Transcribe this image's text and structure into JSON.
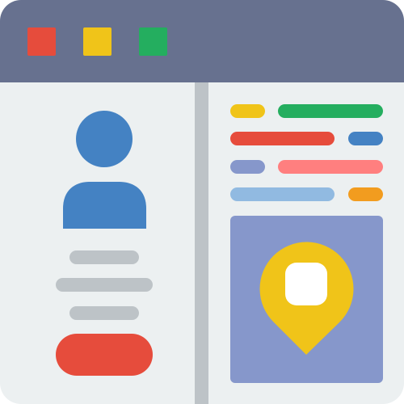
{
  "window": {
    "frame_color": "#ECF0F1",
    "titlebar_color": "#67718F",
    "divider_color": "#BDC3C7",
    "controls": [
      {
        "name": "close",
        "color": "#E64C3C"
      },
      {
        "name": "minimize",
        "color": "#F0C419"
      },
      {
        "name": "maximize",
        "color": "#24AE5F"
      }
    ]
  },
  "profile": {
    "icon": "user-avatar-icon",
    "avatar_color": "#4482C3",
    "text_line_color": "#BDC3C7",
    "action_button_color": "#E64C3C"
  },
  "details": {
    "rows": [
      [
        {
          "color": "#F0C419"
        },
        {
          "color": "#24AE5F"
        }
      ],
      [
        {
          "color": "#E64C3C"
        },
        {
          "color": "#4482C3"
        }
      ],
      [
        {
          "color": "#8697CB"
        },
        {
          "color": "#FF7F7F"
        }
      ],
      [
        {
          "color": "#91BAE1"
        },
        {
          "color": "#F29C1F"
        }
      ]
    ]
  },
  "map": {
    "background_color": "#8697CB",
    "pin_icon": "map-pin-icon",
    "pin_color": "#F0C419",
    "pin_inner_color": "#FFFFFF"
  }
}
